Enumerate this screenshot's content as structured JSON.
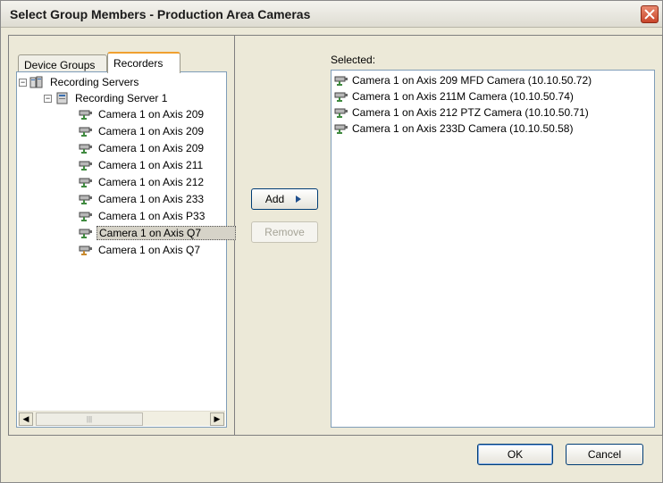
{
  "window": {
    "title": "Select Group Members - Production Area Cameras"
  },
  "tabs": [
    {
      "label": "Device Groups"
    },
    {
      "label": "Recorders"
    }
  ],
  "tree": {
    "root": "Recording Servers",
    "server": "Recording Server 1",
    "cameras": [
      "Camera 1 on Axis 209",
      "Camera 1 on Axis 209",
      "Camera 1 on Axis 209",
      "Camera 1 on Axis 211",
      "Camera 1 on Axis 212",
      "Camera 1 on Axis 233",
      "Camera 1 on Axis P33",
      "Camera 1 on Axis Q7",
      "Camera 1 on Axis Q7"
    ]
  },
  "buttons": {
    "add": "Add",
    "remove": "Remove",
    "ok": "OK",
    "cancel": "Cancel"
  },
  "selected": {
    "label": "Selected:",
    "items": [
      "Camera 1 on Axis 209 MFD Camera (10.10.50.72)",
      "Camera 1 on Axis 211M Camera (10.10.50.74)",
      "Camera 1 on Axis 212 PTZ Camera (10.10.50.71)",
      "Camera 1 on Axis 233D Camera (10.10.50.58)"
    ]
  },
  "icons": {
    "camera": "camera-icon",
    "server": "server-icon",
    "servers": "servers-icon",
    "close": "close-icon",
    "arrow": "triangle-right-icon"
  }
}
